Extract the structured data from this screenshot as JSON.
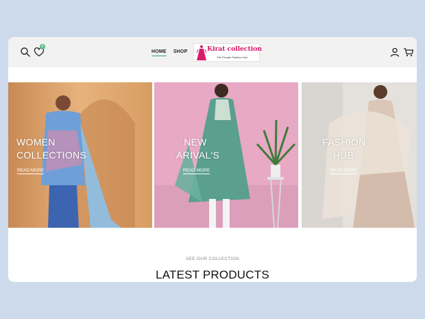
{
  "header": {
    "wishlist_count": "0",
    "nav": [
      {
        "label": "HOME",
        "active": true
      },
      {
        "label": "SHOP",
        "active": false
      }
    ],
    "logo": {
      "name": "Kirat collection",
      "tagline": "The Female Fashion Hub"
    },
    "icons": [
      "search-icon",
      "heart-icon",
      "user-icon",
      "cart-icon"
    ]
  },
  "banners": [
    {
      "title_line1": "WOMEN",
      "title_line2": "COLLECTIONS",
      "link": "READ MORE"
    },
    {
      "title_line1": "NEW",
      "title_line2": "ARIVAL'S",
      "link": "READ MORE"
    },
    {
      "title_line1": "FASHION",
      "title_line2": "HUB",
      "link": "READ MORE"
    }
  ],
  "section": {
    "subtitle": "SEE OUR COLLECTION",
    "title": "LATEST PRODUCTS"
  },
  "colors": {
    "page_background": "#ccdaec",
    "accent": "#2fa372",
    "logo_pink": "#d81d6b"
  }
}
